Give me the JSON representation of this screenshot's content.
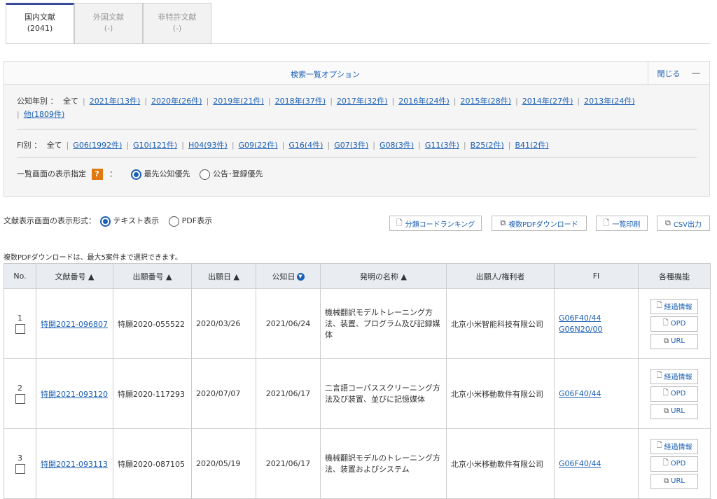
{
  "tabs": [
    {
      "label": "国内文献",
      "count": "(2041)"
    },
    {
      "label": "外国文献",
      "count": "(-)"
    },
    {
      "label": "非特許文献",
      "count": "(-)"
    }
  ],
  "options": {
    "title": "検索一覧オプション",
    "close_label": "閉じる",
    "close_icon": "—",
    "year_label": "公知年別 ：",
    "year_all": "全て",
    "years": [
      "2021年(13件)",
      "2020年(26件)",
      "2019年(21件)",
      "2018年(37件)",
      "2017年(32件)",
      "2016年(24件)",
      "2015年(28件)",
      "2014年(27件)",
      "2013年(24件)"
    ],
    "year_other": "他(1809件)",
    "fi_label": "FI別 ：",
    "fi_all": "全て",
    "fis": [
      "G06(1992件)",
      "G10(121件)",
      "H04(93件)",
      "G09(22件)",
      "G16(4件)",
      "G07(3件)",
      "G08(3件)",
      "G11(3件)",
      "B25(2件)",
      "B41(2件)"
    ],
    "display_label": "一覧画面の表示指定",
    "display_colon": "：",
    "display_options": [
      "最先公知優先",
      "公告･登録優先"
    ],
    "help_icon": "?"
  },
  "format": {
    "label": "文献表示画面の表示形式：",
    "options": [
      "テキスト表示",
      "PDF表示"
    ]
  },
  "toolbar": {
    "ranking": "分類コードランキング",
    "multi_pdf": "複数PDFダウンロード",
    "print": "一覧印刷",
    "csv": "CSV出力"
  },
  "note": "複数PDFダウンロードは、最大5案件まで選択できます。",
  "table": {
    "headers": {
      "no": "No.",
      "doc": "文献番号 ▲",
      "app": "出願番号 ▲",
      "app_date": "出願日 ▲",
      "pub_date": "公知日",
      "title": "発明の名称 ▲",
      "applicant": "出願人/権利者",
      "fi": "FI",
      "func": "各種機能"
    },
    "functions": {
      "history": "経過情報",
      "opd": "OPD",
      "url": "URL"
    },
    "rows": [
      {
        "no": "1",
        "doc": "特開2021-096807",
        "app": "特願2020-055522",
        "app_date": "2020/03/26",
        "pub_date": "2021/06/24",
        "title": "機械翻訳モデルトレーニング方法、装置、プログラム及び記録媒体",
        "applicant": "北京小米智能科技有限公司",
        "fi": [
          "G06F40/44",
          "G06N20/00"
        ]
      },
      {
        "no": "2",
        "doc": "特開2021-093120",
        "app": "特願2020-117293",
        "app_date": "2020/07/07",
        "pub_date": "2021/06/17",
        "title": "二言語コーパススクリーニング方法及び装置、並びに記憶媒体",
        "applicant": "北京小米移動軟件有限公司",
        "fi": [
          "G06F40/44"
        ]
      },
      {
        "no": "3",
        "doc": "特開2021-093113",
        "app": "特願2020-087105",
        "app_date": "2020/05/19",
        "pub_date": "2021/06/17",
        "title": "機械翻訳モデルのトレーニング方法、装置およびシステム",
        "applicant": "北京小米移動軟件有限公司",
        "fi": [
          "G06F40/44"
        ]
      }
    ]
  }
}
